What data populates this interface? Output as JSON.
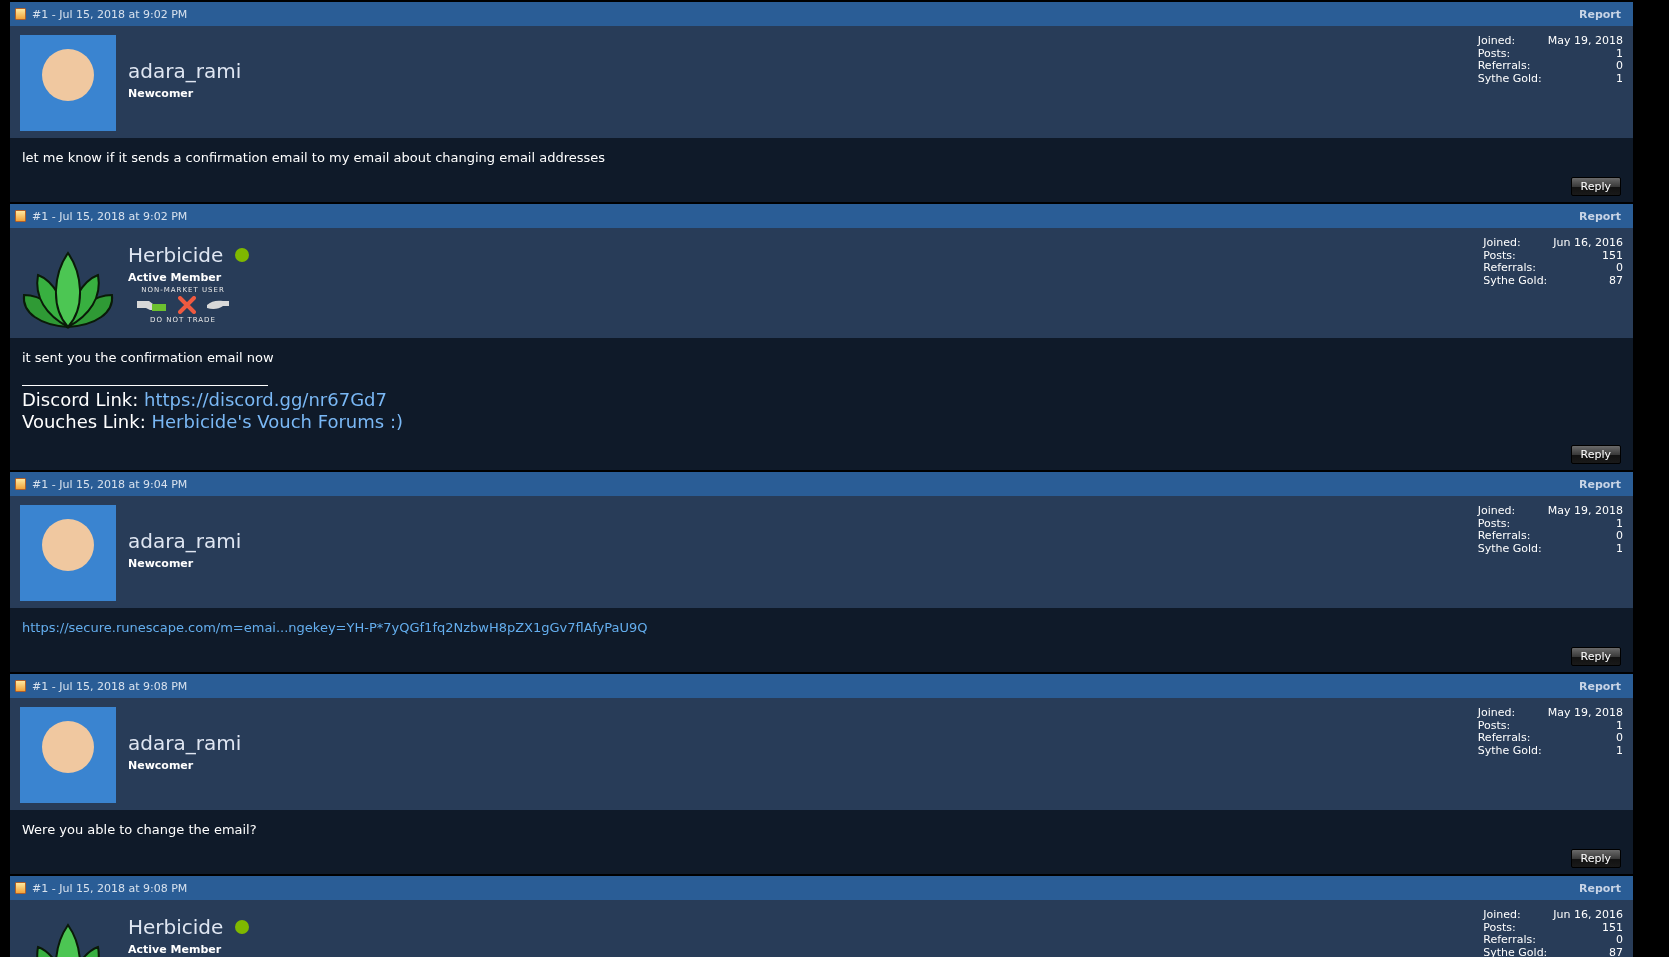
{
  "posts": [
    {
      "meta": "#1 - Jul 15, 2018 at 9:02 PM",
      "report": "Report",
      "user": {
        "name": "adara_rami",
        "rank": "Newcomer",
        "avatar": {
          "kind": "photo"
        },
        "online": false
      },
      "stats": [
        {
          "label": "Joined:",
          "value": "May 19, 2018"
        },
        {
          "label": "Posts:",
          "value": "1"
        },
        {
          "label": "Referrals:",
          "value": "0"
        },
        {
          "label": "Sythe Gold:",
          "value": "1"
        }
      ],
      "body": [
        {
          "kind": "text",
          "text": "let me know if it sends a confirmation email to my email about changing email addresses"
        }
      ],
      "reply": "Reply"
    },
    {
      "meta": "#1 - Jul 15, 2018 at 9:02 PM",
      "report": "Report",
      "user": {
        "name": "Herbicide",
        "rank": "Active Member",
        "avatar": {
          "kind": "leaf"
        },
        "online": true,
        "badge": {
          "top": "NON-MARKET USER",
          "bottom": "DO NOT TRADE"
        }
      },
      "stats": [
        {
          "label": "Joined:",
          "value": "Jun 16, 2016"
        },
        {
          "label": "Posts:",
          "value": "151"
        },
        {
          "label": "Referrals:",
          "value": "0"
        },
        {
          "label": "Sythe Gold:",
          "value": "87"
        }
      ],
      "body": [
        {
          "kind": "text",
          "text": "it sent you the confirmation email now"
        },
        {
          "kind": "signature",
          "lines": [
            {
              "label": "Discord Link:",
              "link": "https://discord.gg/nr67Gd7"
            },
            {
              "label": "Vouches Link:",
              "link": "Herbicide's Vouch Forums :)"
            }
          ]
        }
      ],
      "reply": "Reply"
    },
    {
      "meta": "#1 - Jul 15, 2018 at 9:04 PM",
      "report": "Report",
      "user": {
        "name": "adara_rami",
        "rank": "Newcomer",
        "avatar": {
          "kind": "photo"
        },
        "online": false
      },
      "stats": [
        {
          "label": "Joined:",
          "value": "May 19, 2018"
        },
        {
          "label": "Posts:",
          "value": "1"
        },
        {
          "label": "Referrals:",
          "value": "0"
        },
        {
          "label": "Sythe Gold:",
          "value": "1"
        }
      ],
      "body": [
        {
          "kind": "link",
          "text": "https://secure.runescape.com/m=emai...ngekey=YH-P*7yQGf1fq2NzbwH8pZX1gGv7flAfyPaU9Q"
        }
      ],
      "reply": "Reply"
    },
    {
      "meta": "#1 - Jul 15, 2018 at 9:08 PM",
      "report": "Report",
      "user": {
        "name": "adara_rami",
        "rank": "Newcomer",
        "avatar": {
          "kind": "photo"
        },
        "online": false
      },
      "stats": [
        {
          "label": "Joined:",
          "value": "May 19, 2018"
        },
        {
          "label": "Posts:",
          "value": "1"
        },
        {
          "label": "Referrals:",
          "value": "0"
        },
        {
          "label": "Sythe Gold:",
          "value": "1"
        }
      ],
      "body": [
        {
          "kind": "text",
          "text": "Were you able to change the email?"
        }
      ],
      "reply": "Reply"
    },
    {
      "meta": "#1 - Jul 15, 2018 at 9:08 PM",
      "report": "Report",
      "user": {
        "name": "Herbicide",
        "rank": "Active Member",
        "avatar": {
          "kind": "leaf"
        },
        "online": true
      },
      "stats": [
        {
          "label": "Joined:",
          "value": "Jun 16, 2016"
        },
        {
          "label": "Posts:",
          "value": "151"
        },
        {
          "label": "Referrals:",
          "value": "0"
        },
        {
          "label": "Sythe Gold:",
          "value": "87"
        }
      ]
    }
  ]
}
